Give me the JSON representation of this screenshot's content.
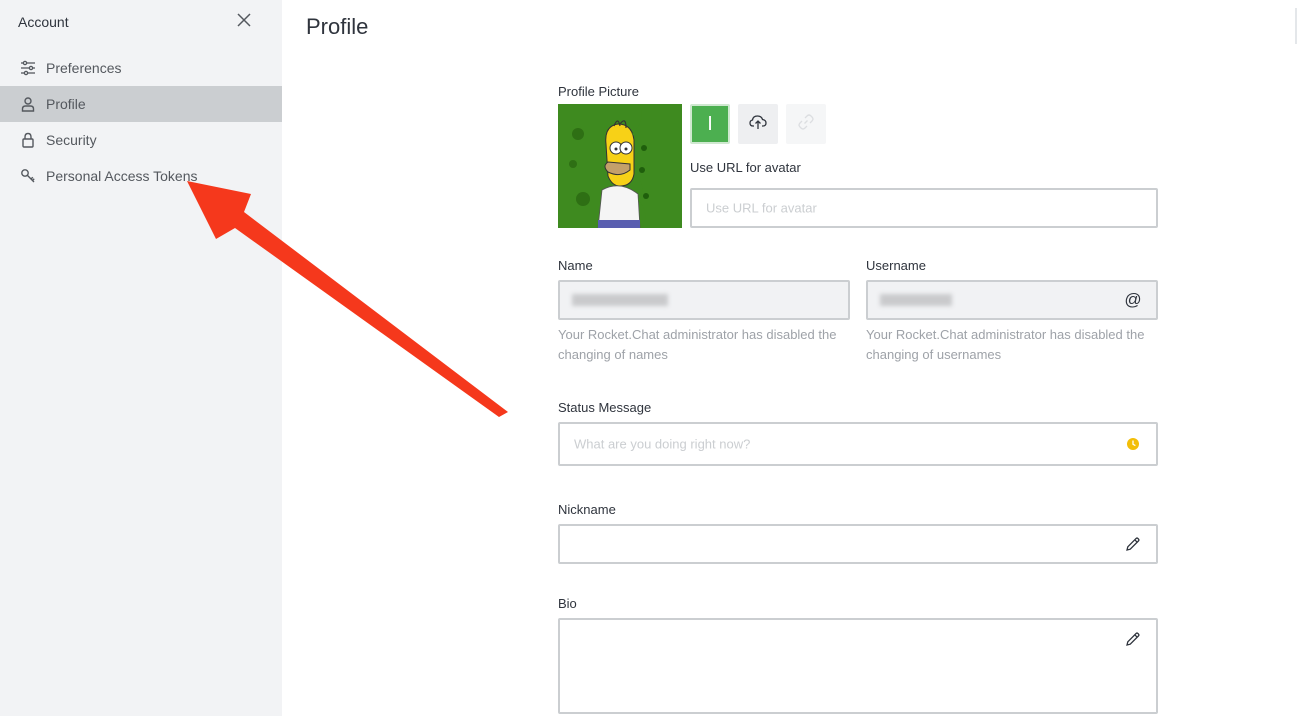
{
  "sidebar": {
    "title": "Account",
    "items": [
      {
        "label": "Preferences",
        "icon": "sliders-icon",
        "active": false
      },
      {
        "label": "Profile",
        "icon": "user-icon",
        "active": true
      },
      {
        "label": "Security",
        "icon": "lock-icon",
        "active": false
      },
      {
        "label": "Personal Access Tokens",
        "icon": "key-icon",
        "active": false
      }
    ]
  },
  "main": {
    "title": "Profile",
    "profile_picture": {
      "label": "Profile Picture",
      "initial_button": "I",
      "url_label": "Use URL for avatar",
      "url_placeholder": "Use URL for avatar"
    },
    "name": {
      "label": "Name",
      "hint": "Your Rocket.Chat administrator has disabled the changing of names"
    },
    "username": {
      "label": "Username",
      "hint": "Your Rocket.Chat administrator has disabled the changing of usernames",
      "icon_glyph": "@"
    },
    "status": {
      "label": "Status Message",
      "placeholder": "What are you doing right now?"
    },
    "nickname": {
      "label": "Nickname"
    },
    "bio": {
      "label": "Bio"
    }
  },
  "colors": {
    "sidebar_bg": "#f2f3f5",
    "active_item_bg": "#cbced1",
    "avatar_bg": "#3e8a1f",
    "initial_button_bg": "#4caf50",
    "status_away": "#f3be08",
    "annotation_arrow": "#f5381c"
  }
}
